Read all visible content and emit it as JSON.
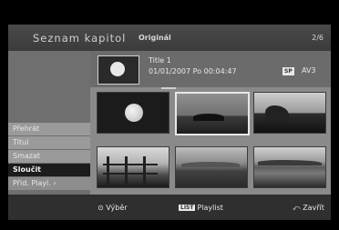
{
  "header": {
    "title": "Seznam kapitol",
    "subtitle": "Originál",
    "page": "2/6"
  },
  "info": {
    "title": "Title 1",
    "datetime": "01/01/2007  Po  00:04:47",
    "mode": "SP",
    "channel": "AV3"
  },
  "menu": {
    "items": [
      "Přehrát",
      "Titul",
      "Smazat",
      "Sloučit",
      "Přid. Playl. ›"
    ],
    "selected": "Sloučit"
  },
  "thumbnails": [
    {
      "scene": "moon",
      "selected": false
    },
    {
      "scene": "sea-island",
      "selected": true
    },
    {
      "scene": "shore",
      "selected": false
    },
    {
      "scene": "fence",
      "selected": false
    },
    {
      "scene": "field",
      "selected": false
    },
    {
      "scene": "lake",
      "selected": false
    }
  ],
  "bottom": {
    "select_label": "⊙ Výběr",
    "playlist_badge": "LIST",
    "playlist_label": "Playlist",
    "close_label": "⤺ Zavřít"
  }
}
